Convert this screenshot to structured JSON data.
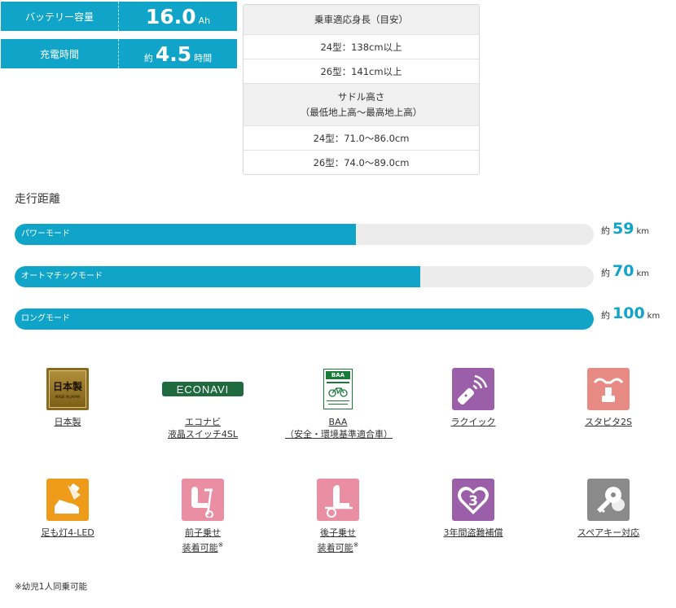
{
  "specs": {
    "battery": {
      "label": "バッテリー容量",
      "prefix": "",
      "value": "16.0",
      "unit": "Ah"
    },
    "charge": {
      "label": "充電時間",
      "prefix": "約",
      "value": "4.5",
      "unit": "時間"
    }
  },
  "height_table": {
    "header1": "乗車適応身長（目安）",
    "rider_24": "24型：138cm以上",
    "rider_26": "26型：141cm以上",
    "header2_line1": "サドル高さ",
    "header2_line2": "（最低地上高～最高地上高）",
    "saddle_24": "24型：71.0～86.0cm",
    "saddle_26": "26型：74.0～89.0cm"
  },
  "range": {
    "title": "走行距離",
    "max": 100,
    "modes": [
      {
        "label": "パワーモード",
        "prefix": "約",
        "value": 59,
        "unit": "km"
      },
      {
        "label": "オートマチックモード",
        "prefix": "約",
        "value": 70,
        "unit": "km"
      },
      {
        "label": "ロングモード",
        "prefix": "約",
        "value": 100,
        "unit": "km"
      }
    ]
  },
  "features": {
    "made_in_japan": {
      "caption": "日本製",
      "badge_text": "日本製",
      "badge_sub": "MADE IN JAPAN",
      "color": "#8a6a1c"
    },
    "econavi": {
      "caption1": "エコナビ",
      "caption2": "液晶スイッチ4SL",
      "logo_text": "ECONAVI",
      "color": "#1f6b3f"
    },
    "baa": {
      "caption1": "BAA",
      "caption2": "（安全・環境基準適合車）",
      "logo_text": "BAA",
      "color": "#1a7a3a"
    },
    "raquick": {
      "caption": "ラクイック",
      "color": "#9b5ea8"
    },
    "stapita": {
      "caption": "スタピタ2S",
      "color": "#e88a84"
    },
    "footlight": {
      "caption": "足も灯4-LED",
      "color": "#ee9b1a"
    },
    "front_child": {
      "caption1": "前子乗せ",
      "caption2": "装着可能",
      "mark": "※",
      "color": "#ea8fa3"
    },
    "rear_child": {
      "caption1": "後子乗せ",
      "caption2": "装着可能",
      "mark": "※",
      "color": "#ea8fa3"
    },
    "theft": {
      "caption": "3年間盗難補償",
      "number": "3",
      "color": "#9b5ea8"
    },
    "spare_key": {
      "caption": "スペアキー対応",
      "color": "#8a8a8a"
    }
  },
  "note": "※幼児1人同乗可能",
  "accent": "#10a4c8"
}
